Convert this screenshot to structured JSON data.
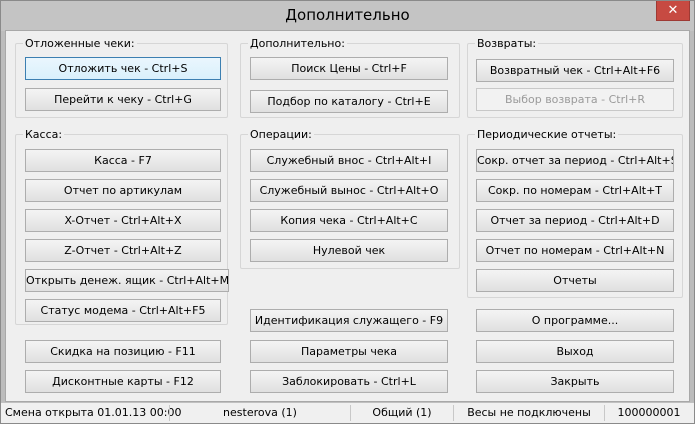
{
  "window": {
    "title": "Дополнительно",
    "close_glyph": "✕"
  },
  "groups": {
    "deferred": {
      "title": "Отложенные чеки:",
      "buttons": [
        "Отложить чек - Ctrl+S",
        "Перейти к чеку - Ctrl+G"
      ]
    },
    "additional": {
      "title": "Дополнительно:",
      "buttons": [
        "Поиск Цены - Ctrl+F",
        "Подбор по каталогу - Ctrl+E"
      ]
    },
    "returns": {
      "title": "Возвраты:",
      "buttons": [
        "Возвратный чек - Ctrl+Alt+F6",
        "Выбор возврата - Ctrl+R"
      ]
    },
    "cash": {
      "title": "Касса:",
      "buttons": [
        "Касса - F7",
        "Отчет по артикулам",
        "X-Отчет - Ctrl+Alt+X",
        "Z-Отчет - Ctrl+Alt+Z",
        "Открыть денеж. ящик - Ctrl+Alt+M",
        "Статус модема - Ctrl+Alt+F5"
      ]
    },
    "operations": {
      "title": "Операции:",
      "buttons": [
        "Служебный внос - Ctrl+Alt+I",
        "Служебный вынос - Ctrl+Alt+O",
        "Копия чека - Ctrl+Alt+C",
        "Нулевой чек"
      ]
    },
    "periodic": {
      "title": "Периодические отчеты:",
      "buttons": [
        "Сокр. отчет за период - Ctrl+Alt+S",
        "Сокр. по номерам  - Ctrl+Alt+T",
        "Отчет за период - Ctrl+Alt+D",
        "Отчет по номерам - Ctrl+Alt+N",
        "Отчеты"
      ]
    }
  },
  "bottom": {
    "left": [
      "Скидка на позицию - F11",
      "Дисконтные карты - F12"
    ],
    "middle": [
      "Идентификация служащего - F9",
      "Параметры чека",
      "Заблокировать - Ctrl+L"
    ],
    "right": [
      "О программе...",
      "Выход",
      "Закрыть"
    ]
  },
  "statusbar": {
    "shift": "Смена открыта 01.01.13 00:00",
    "user": "nesterova (1)",
    "mode": "Общий (1)",
    "scales": "Весы не подключены",
    "number": "100000001"
  },
  "colors": {
    "close_button": "#c74a42",
    "focus_border": "#3c7fb1",
    "disabled_text": "#9a9a9a"
  }
}
